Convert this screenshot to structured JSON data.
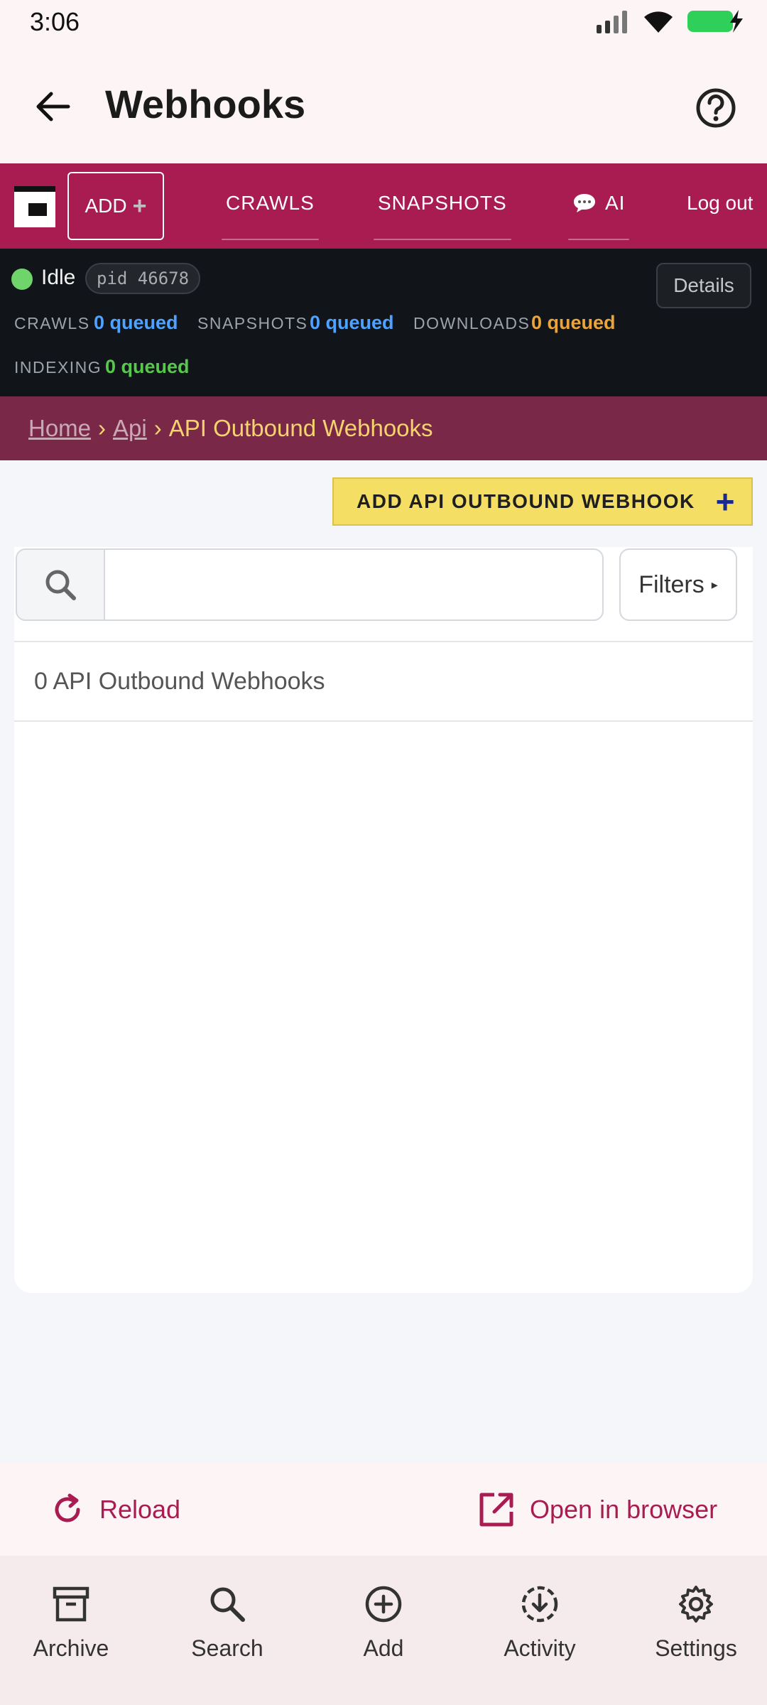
{
  "status_bar": {
    "time": "3:06"
  },
  "app_bar": {
    "title": "Webhooks"
  },
  "web_nav": {
    "add_label": "ADD",
    "links": [
      "CRAWLS",
      "SNAPSHOTS",
      "AI",
      "Log out"
    ]
  },
  "orchestrator": {
    "state": "Idle",
    "pid": "pid 46678",
    "details_label": "Details",
    "queues": [
      {
        "label": "CRAWLS",
        "value": "0 queued"
      },
      {
        "label": "SNAPSHOTS",
        "value": "0 queued"
      },
      {
        "label": "DOWNLOADS",
        "value": "0 queued"
      },
      {
        "label": "INDEXING",
        "value": "0 queued"
      }
    ]
  },
  "breadcrumb": {
    "home": "Home",
    "api": "Api",
    "current": "API Outbound Webhooks",
    "sep": "›"
  },
  "add_webhook": {
    "label": "ADD API OUTBOUND WEBHOOK"
  },
  "search": {
    "value": "",
    "placeholder": ""
  },
  "filters": {
    "label": "Filters"
  },
  "results": {
    "count_text": "0 API Outbound Webhooks"
  },
  "actions": {
    "reload": "Reload",
    "open_browser": "Open in browser"
  },
  "bottom_nav": {
    "items": [
      "Archive",
      "Search",
      "Add",
      "Activity",
      "Settings"
    ]
  },
  "colors": {
    "brand": "#a91c52",
    "breadcrumb_bg": "#7a2848",
    "accent_yellow": "#f5de64",
    "queued_blue": "#4da3ff",
    "queued_orange": "#e9a53a",
    "queued_green": "#57c84d",
    "status_dot": "#6fd46a"
  }
}
